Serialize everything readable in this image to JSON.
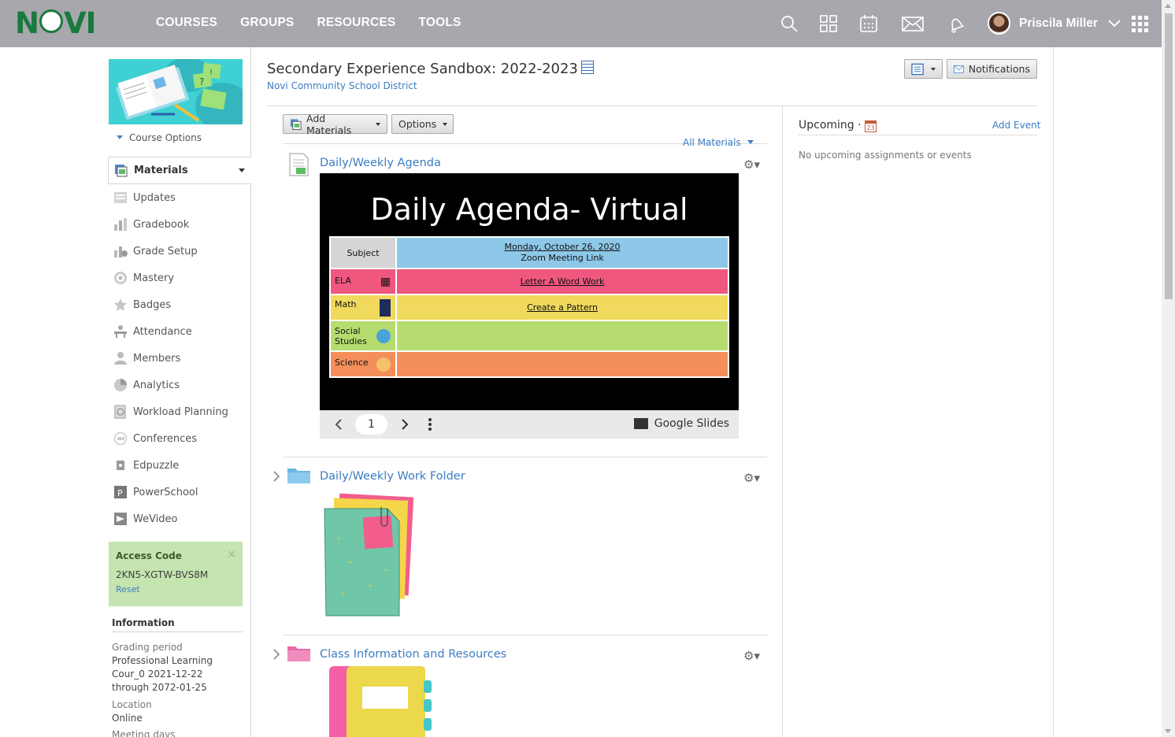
{
  "header": {
    "logo_text": "NOVI",
    "nav": [
      "COURSES",
      "GROUPS",
      "RESOURCES",
      "TOOLS"
    ],
    "icons": [
      "search-icon",
      "apps-grid-icon",
      "calendar-icon",
      "mail-icon",
      "bell-icon",
      "chevron-down-icon",
      "waffle-menu-icon"
    ],
    "user_name": "Priscila Miller"
  },
  "sidebar": {
    "course_options": "Course Options",
    "items": [
      {
        "label": "Materials",
        "icon": "materials-icon",
        "active": true
      },
      {
        "label": "Updates",
        "icon": "updates-icon"
      },
      {
        "label": "Gradebook",
        "icon": "gradebook-icon"
      },
      {
        "label": "Grade Setup",
        "icon": "grade-setup-icon"
      },
      {
        "label": "Mastery",
        "icon": "mastery-icon"
      },
      {
        "label": "Badges",
        "icon": "badges-icon"
      },
      {
        "label": "Attendance",
        "icon": "attendance-icon"
      },
      {
        "label": "Members",
        "icon": "members-icon"
      },
      {
        "label": "Analytics",
        "icon": "analytics-icon"
      },
      {
        "label": "Workload Planning",
        "icon": "workload-icon"
      },
      {
        "label": "Conferences",
        "icon": "conferences-icon"
      },
      {
        "label": "Edpuzzle",
        "icon": "edpuzzle-icon"
      },
      {
        "label": "PowerSchool",
        "icon": "powerschool-icon"
      },
      {
        "label": "WeVideo",
        "icon": "wevideo-icon"
      }
    ],
    "access_code": {
      "title": "Access Code",
      "code": "2KN5-XGTW-BVS8M",
      "reset": "Reset",
      "close": "×"
    },
    "information": {
      "title": "Information",
      "grading_period_label": "Grading period",
      "grading_period_value": "Professional Learning Cour_0 2021-12-22 through 2072-01-25",
      "location_label": "Location",
      "location_value": "Online",
      "meeting_days_label": "Meeting days"
    }
  },
  "main": {
    "title": "Secondary Experience Sandbox: 2022-2023",
    "district": "Novi Community School District",
    "toolbar": {
      "notifications": "Notifications",
      "add_materials": "Add Materials",
      "options": "Options",
      "all_materials": "All Materials"
    },
    "materials": [
      {
        "title": "Daily/Weekly Agenda",
        "type": "page"
      },
      {
        "title": "Daily/Weekly Work Folder",
        "type": "folder",
        "color": "#6ab7e6"
      },
      {
        "title": "Class Information and Resources",
        "type": "folder",
        "color": "#e96aa8"
      }
    ],
    "slide": {
      "title": "Daily Agenda- Virtual",
      "header_subject": "Subject",
      "header_date": "Monday, October 26, 2020",
      "header_link": "Zoom Meeting Link",
      "rows": [
        {
          "subject": "ELA",
          "link": "Letter A Word Work",
          "color": "#f0577e"
        },
        {
          "subject": "Math",
          "link": "Create a Pattern",
          "color": "#f0d95c"
        },
        {
          "subject": "Social Studies",
          "link": "",
          "color": "#b6dc6f"
        },
        {
          "subject": "Science",
          "link": "",
          "color": "#f48f5b"
        }
      ],
      "header_color": "#8ec8e8",
      "page": "1",
      "viewer": "Google Slides"
    }
  },
  "upcoming": {
    "title": "Upcoming",
    "cal_day": "23",
    "add_event": "Add Event",
    "empty": "No upcoming assignments or events"
  }
}
